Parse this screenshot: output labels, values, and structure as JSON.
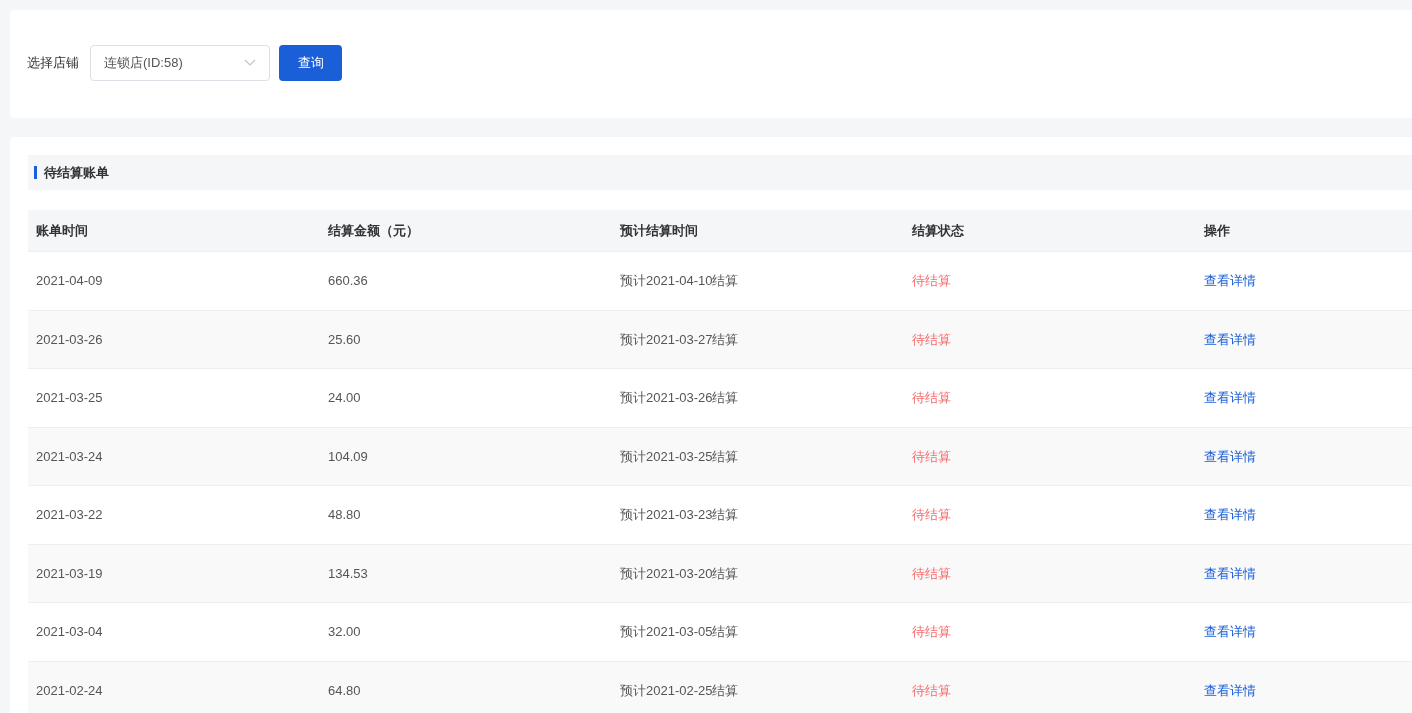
{
  "filter": {
    "label": "选择店铺",
    "store_select": {
      "value": "连锁店(ID:58)"
    },
    "query_button": "查询"
  },
  "section": {
    "title": "待结算账单"
  },
  "table": {
    "columns": [
      "账单时间",
      "结算金额（元）",
      "预计结算时间",
      "结算状态",
      "操作"
    ],
    "rows": [
      {
        "date": "2021-04-09",
        "amount": "660.36",
        "expected": "预计2021-04-10结算",
        "status": "待结算",
        "action": "查看详情"
      },
      {
        "date": "2021-03-26",
        "amount": "25.60",
        "expected": "预计2021-03-27结算",
        "status": "待结算",
        "action": "查看详情"
      },
      {
        "date": "2021-03-25",
        "amount": "24.00",
        "expected": "预计2021-03-26结算",
        "status": "待结算",
        "action": "查看详情"
      },
      {
        "date": "2021-03-24",
        "amount": "104.09",
        "expected": "预计2021-03-25结算",
        "status": "待结算",
        "action": "查看详情"
      },
      {
        "date": "2021-03-22",
        "amount": "48.80",
        "expected": "预计2021-03-23结算",
        "status": "待结算",
        "action": "查看详情"
      },
      {
        "date": "2021-03-19",
        "amount": "134.53",
        "expected": "预计2021-03-20结算",
        "status": "待结算",
        "action": "查看详情"
      },
      {
        "date": "2021-03-04",
        "amount": "32.00",
        "expected": "预计2021-03-05结算",
        "status": "待结算",
        "action": "查看详情"
      },
      {
        "date": "2021-02-24",
        "amount": "64.80",
        "expected": "预计2021-02-25结算",
        "status": "待结算",
        "action": "查看详情"
      }
    ]
  }
}
